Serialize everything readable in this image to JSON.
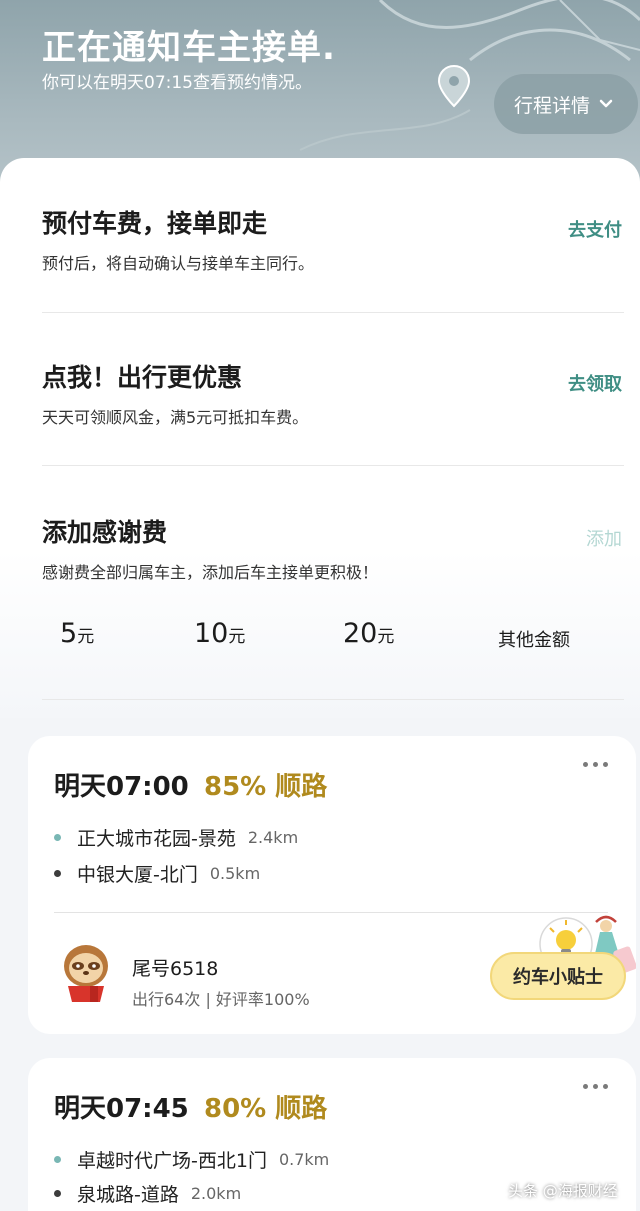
{
  "header": {
    "title": "正在通知车主接单.",
    "subtitle": "你可以在明天07:15查看预约情况。",
    "detail_label": "行程详情"
  },
  "prepay": {
    "title": "预付车费，接单即走",
    "subtitle": "预付后，将自动确认与接单车主同行。",
    "action": "去支付"
  },
  "promo": {
    "title": "点我！出行更优惠",
    "subtitle": "天天可领顺风金，满5元可抵扣车费。",
    "action": "去领取"
  },
  "thanks": {
    "title": "添加感谢费",
    "subtitle": "感谢费全部归属车主，添加后车主接单更积极！",
    "action": "添加",
    "amounts": [
      {
        "value": "5",
        "unit": "元"
      },
      {
        "value": "10",
        "unit": "元"
      },
      {
        "value": "20",
        "unit": "元"
      }
    ],
    "other": "其他金额"
  },
  "cards": [
    {
      "time": "明天07:00",
      "match": "85% 顺路",
      "start": {
        "name": "正大城市花园-景苑",
        "dist": "2.4km"
      },
      "end": {
        "name": "中银大厦-北门",
        "dist": "0.5km"
      },
      "driver": {
        "name": "尾号6518",
        "stats": "出行64次 | 好评率100%"
      }
    },
    {
      "time": "明天07:45",
      "match": "80% 顺路",
      "start": {
        "name": "卓越时代广场-西北1门",
        "dist": "0.7km"
      },
      "end": {
        "name": "泉城路-道路",
        "dist": "2.0km"
      }
    }
  ],
  "tips_label": "约车小贴士",
  "watermark": "头条 @海报财经",
  "colors": {
    "accent": "#3f8e84",
    "match": "#b08a1e",
    "tips_bg": "#fbeaa6"
  }
}
